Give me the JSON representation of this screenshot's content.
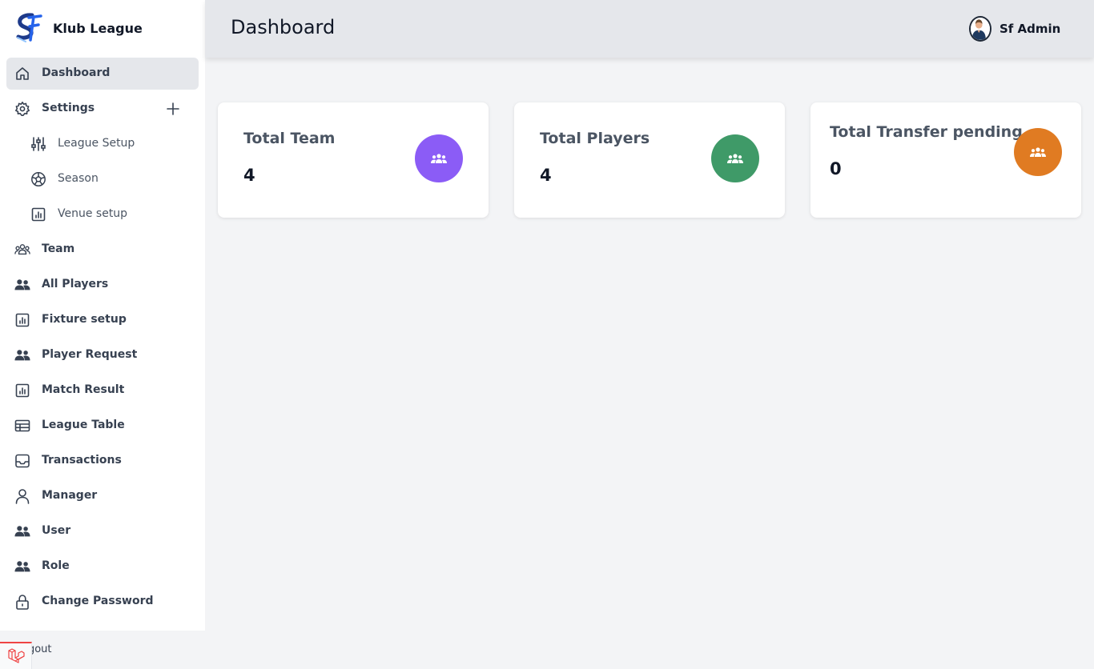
{
  "brand": {
    "title": "Klub League"
  },
  "header": {
    "title": "Dashboard",
    "user_name": "Sf Admin"
  },
  "sidebar": {
    "items": [
      {
        "label": "Dashboard",
        "icon": "home-icon",
        "active": true
      },
      {
        "label": "Settings",
        "icon": "gear-icon",
        "expandable": true
      },
      {
        "label": "League Setup",
        "icon": "sliders-icon",
        "sub": true
      },
      {
        "label": "Season",
        "icon": "soccer-ball-icon",
        "sub": true
      },
      {
        "label": "Venue setup",
        "icon": "bar-chart-icon",
        "sub": true
      },
      {
        "label": "Team",
        "icon": "user-group-icon"
      },
      {
        "label": "All Players",
        "icon": "users-icon"
      },
      {
        "label": "Fixture setup",
        "icon": "bar-chart-icon"
      },
      {
        "label": "Player Request",
        "icon": "users-icon"
      },
      {
        "label": "Match Result",
        "icon": "bar-chart-icon"
      },
      {
        "label": "League Table",
        "icon": "table-icon"
      },
      {
        "label": "Transactions",
        "icon": "inbox-icon"
      },
      {
        "label": "Manager",
        "icon": "user-icon"
      },
      {
        "label": "User",
        "icon": "users-icon"
      },
      {
        "label": "Role",
        "icon": "users-icon"
      },
      {
        "label": "Change Password",
        "icon": "lock-icon"
      }
    ],
    "logout_label": "Logout"
  },
  "cards": [
    {
      "title": "Total Team",
      "value": "4",
      "color": "#8b5cf6",
      "icon": "user-group-icon"
    },
    {
      "title": "Total Players",
      "value": "4",
      "color": "#3f9a68",
      "icon": "user-group-icon"
    },
    {
      "title": "Total Transfer pending",
      "value": "0",
      "color": "#e07b22",
      "icon": "user-group-icon"
    }
  ],
  "colors": {
    "sidebar_bg": "#ffffff",
    "topbar_bg": "#e5e7eb",
    "page_bg": "#f3f4f6",
    "active_item_bg": "#e5e7eb"
  }
}
